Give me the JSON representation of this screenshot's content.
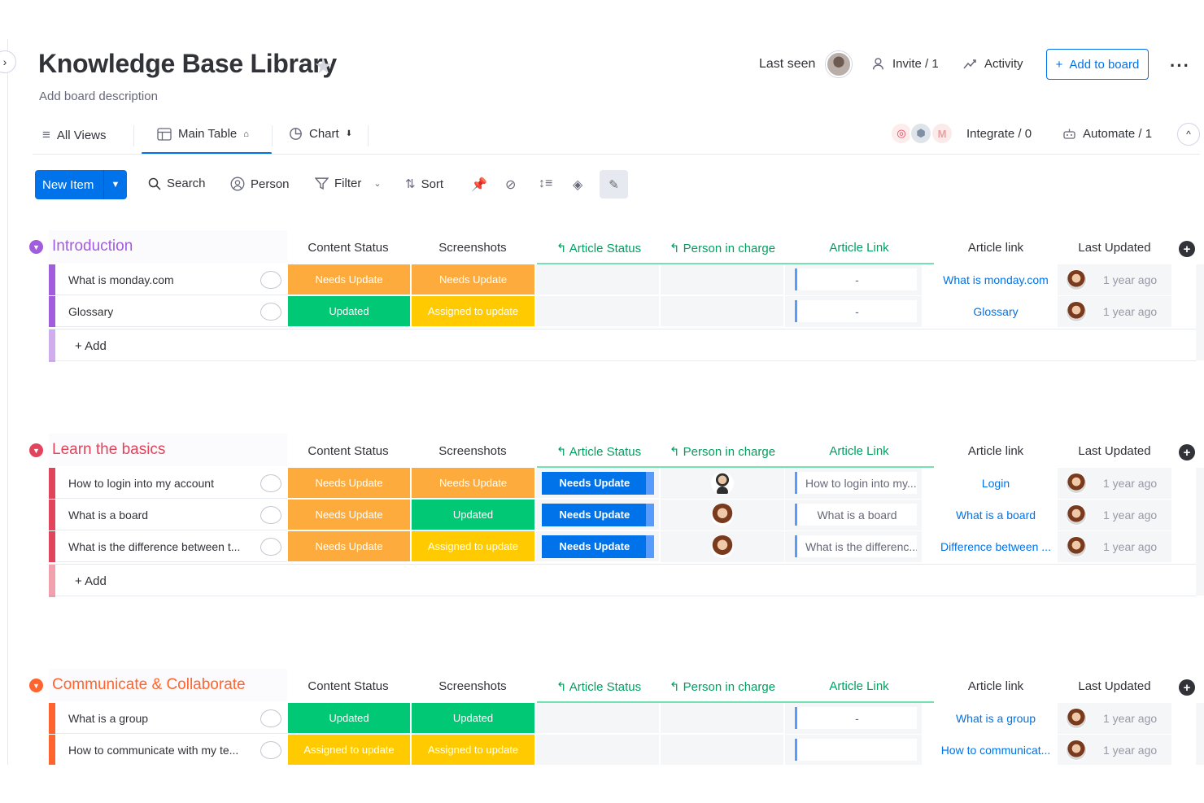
{
  "board": {
    "title": "Knowledge Base Library",
    "description": "Add board description",
    "last_seen_label": "Last seen",
    "invite_label": "Invite / 1",
    "activity_label": "Activity",
    "add_to_board_label": "Add to board"
  },
  "views": {
    "all_views": "All Views",
    "main_table": "Main Table",
    "chart": "Chart",
    "integrate": "Integrate / 0",
    "automate": "Automate / 1"
  },
  "toolbar": {
    "new_item": "New Item",
    "search": "Search",
    "person": "Person",
    "filter": "Filter",
    "sort": "Sort"
  },
  "columns": {
    "content_status": "Content Status",
    "screenshots": "Screenshots",
    "article_status": "Article Status",
    "person_in_charge": "Person in charge",
    "article_link_green": "Article Link",
    "article_link": "Article link",
    "last_updated": "Last Updated"
  },
  "colors": {
    "needs_update": "#fdab3d",
    "updated": "#00c875",
    "assigned": "#ffcb00",
    "blue": "#0073ea",
    "intro": "#a25ddc",
    "basics": "#e2445c",
    "communicate": "#ff642e"
  },
  "groups": [
    {
      "title": "Introduction",
      "add_label": "+ Add",
      "rows": [
        {
          "name": "What is monday.com",
          "content_status": "Needs Update",
          "screenshots": "Needs Update",
          "article_status": "",
          "person": "",
          "link_field": "-",
          "article_link": "What is monday.com",
          "last_updated": "1 year ago"
        },
        {
          "name": "Glossary",
          "content_status": "Updated",
          "screenshots": "Assigned to update",
          "article_status": "",
          "person": "",
          "link_field": "-",
          "article_link": "Glossary",
          "last_updated": "1 year ago"
        }
      ]
    },
    {
      "title": "Learn the basics",
      "add_label": "+ Add",
      "rows": [
        {
          "name": "How to login into my account",
          "content_status": "Needs Update",
          "screenshots": "Needs Update",
          "article_status": "Needs Update",
          "person": "male",
          "link_field": "How to login into my...",
          "article_link": "Login",
          "last_updated": "1 year ago"
        },
        {
          "name": "What is a board",
          "content_status": "Needs Update",
          "screenshots": "Updated",
          "article_status": "Needs Update",
          "person": "female",
          "link_field": "What is a board",
          "article_link": "What is a board",
          "last_updated": "1 year ago"
        },
        {
          "name": "What is the difference between t...",
          "content_status": "Needs Update",
          "screenshots": "Assigned to update",
          "article_status": "Needs Update",
          "person": "female",
          "link_field": "What is the differenc...",
          "article_link": "Difference between ...",
          "last_updated": "1 year ago"
        }
      ]
    },
    {
      "title": "Communicate & Collaborate",
      "add_label": "+ Add",
      "rows": [
        {
          "name": "What is a group",
          "content_status": "Updated",
          "screenshots": "Updated",
          "article_status": "",
          "person": "",
          "link_field": "-",
          "article_link": "What is a group",
          "last_updated": "1 year ago"
        },
        {
          "name": "How to communicate with my te...",
          "content_status": "Assigned to update",
          "screenshots": "Assigned to update",
          "article_status": "",
          "person": "",
          "link_field": "",
          "article_link": "How to communicat...",
          "last_updated": "1 year ago"
        }
      ]
    }
  ]
}
